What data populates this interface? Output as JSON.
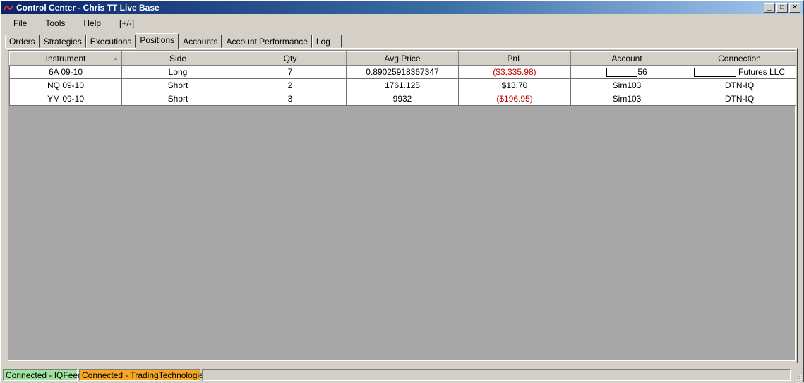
{
  "window": {
    "title": "Control Center - Chris TT Live Base",
    "minimize_glyph": "_",
    "maximize_glyph": "□",
    "close_glyph": "✕"
  },
  "menu": {
    "file": "File",
    "tools": "Tools",
    "help": "Help",
    "toggle": "[+/-]"
  },
  "tabs": {
    "orders": "Orders",
    "strategies": "Strategies",
    "executions": "Executions",
    "positions": "Positions",
    "accounts": "Accounts",
    "account_performance": "Account Performance",
    "log": "Log",
    "active": "Positions"
  },
  "grid": {
    "columns": [
      "Instrument",
      "Side",
      "Qty",
      "Avg Price",
      "PnL",
      "Account",
      "Connection"
    ],
    "sorted_column": "Instrument",
    "sort_direction": "ascending",
    "rows": [
      {
        "instrument": "6A 09-10",
        "side": "Long",
        "qty": "7",
        "avg_price": "0.89025918367347",
        "pnl": "($3,335.98)",
        "account": "56",
        "connection": "Futures LLC"
      },
      {
        "instrument": "NQ 09-10",
        "side": "Short",
        "qty": "2",
        "avg_price": "1761.125",
        "pnl": "$13.70",
        "account": "Sim103",
        "connection": "DTN-IQ"
      },
      {
        "instrument": "YM 09-10",
        "side": "Short",
        "qty": "3",
        "avg_price": "9932",
        "pnl": "($196.95)",
        "account": "Sim103",
        "connection": "DTN-IQ"
      }
    ]
  },
  "statusbar": {
    "iqfeed": "Connected - IQFeed",
    "tt": "Connected - TradingTechnologies"
  },
  "colors": {
    "negative_pnl": "#c00000",
    "status_connected_green": "#9ee39e",
    "status_connected_orange": "#f5a623",
    "titlebar_start": "#0a246a"
  }
}
